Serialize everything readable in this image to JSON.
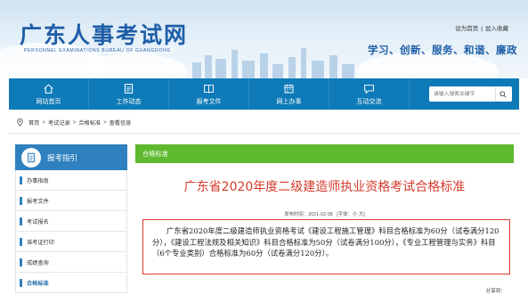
{
  "header": {
    "site_title": "广东人事考试网",
    "site_subtitle": "PERSONNEL EXAMINATIONS BUREAU OF GUANGDONG",
    "top_links": [
      "设为首页",
      "加入收藏"
    ],
    "top_link_separator": "|",
    "slogan": "学习、创新、服务、和谐、廉政"
  },
  "nav": {
    "items": [
      {
        "label": "网站首页",
        "icon": "home-icon"
      },
      {
        "label": "工作动态",
        "icon": "document-icon"
      },
      {
        "label": "报考文件",
        "icon": "book-icon"
      },
      {
        "label": "网上办事",
        "icon": "calendar-icon"
      },
      {
        "label": "互动交流",
        "icon": "chat-icon"
      }
    ],
    "search_placeholder": "请输入搜索关键字"
  },
  "breadcrumb": [
    "首页",
    "考试记录",
    "合格标准",
    "查看信息"
  ],
  "breadcrumb_separator": ">",
  "sidebar": {
    "title": "报考指引",
    "items": [
      "办事指南",
      "报考文件",
      "考试报名",
      "准考证打印",
      "成绩查询",
      "合格标准"
    ],
    "active_index": 5
  },
  "main": {
    "section_label": "合格标准",
    "article_title": "广东省2020年度二级建造师执业资格考试合格标准",
    "meta": {
      "publish_label": "发布时间：2021-02-08",
      "font_label": "[字体：",
      "font_small": "小",
      "font_large": "大",
      "font_close": "]"
    },
    "body": "广东省2020年度二级建造师执业资格考试《建设工程施工管理》科目合格标准为60分（试卷满分120分），《建设工程法规及相关知识》科目合格标准为50分（试卷满分100分），《专业工程管理与实务》科目（6个专业类别）合格标准为60分（试卷满分120分）。",
    "share_label": "分享到："
  },
  "colors": {
    "brand_blue": "#1f5ea8",
    "nav_blue": "#0e7ab8",
    "section_green": "#5eb92e",
    "title_red": "#d43c2c",
    "box_border_red": "#d93a30"
  }
}
